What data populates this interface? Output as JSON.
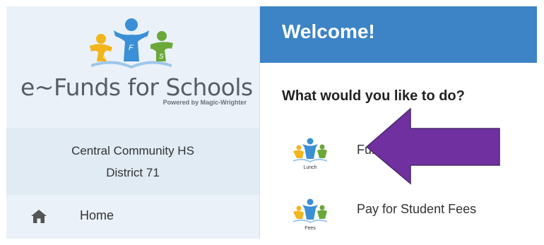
{
  "sidebar": {
    "brand": "e~Funds for Schools",
    "powered_by": "Powered by Magic-Wrighter",
    "logo_letters": [
      "e",
      "F",
      "S"
    ],
    "school_line1": "Central Community HS",
    "school_line2": "District 71",
    "nav": [
      {
        "label": "Home",
        "icon": "home-icon"
      }
    ]
  },
  "main": {
    "welcome": "Welcome!",
    "question": "What would you like to do?",
    "options": [
      {
        "label": "Fun",
        "caption": "Lunch"
      },
      {
        "label": "Pay for Student Fees",
        "caption": "Fees"
      }
    ]
  },
  "colors": {
    "header_blue": "#3d84c6",
    "sidebar_bg": "#eaf1f8",
    "arrow_purple": "#7030a0",
    "logo_yellow": "#f2b51c",
    "logo_blue": "#3b8fd6",
    "logo_green": "#6aa83a"
  }
}
